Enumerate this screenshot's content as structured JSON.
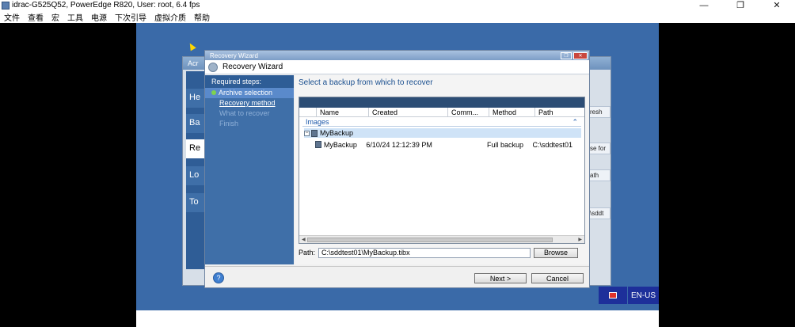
{
  "window": {
    "title": "idrac-G525Q52, PowerEdge R820, User: root, 6.4 fps",
    "minimize": "—",
    "restore": "❐",
    "close": "✕"
  },
  "menubar": {
    "items": [
      "文件",
      "查看",
      "宏",
      "工具",
      "电源",
      "下次引导",
      "虚拟介质",
      "帮助"
    ]
  },
  "background_app": {
    "title": "Acr",
    "nav": [
      "He",
      "Ba",
      "Re",
      "Lo",
      "To"
    ],
    "right_snippets": [
      "resh",
      "se for",
      "ath",
      "\\sddt"
    ]
  },
  "wizard": {
    "window_title": "Recovery Wizard",
    "header_title": "Recovery Wizard",
    "steps_heading": "Required steps:",
    "steps": [
      {
        "label": "Archive selection",
        "state": "current"
      },
      {
        "label": "Recovery method",
        "state": "active"
      },
      {
        "label": "What to recover",
        "state": "disabled"
      },
      {
        "label": "Finish",
        "state": "disabled"
      }
    ],
    "main_title": "Select a backup from which to recover",
    "columns": [
      "Name",
      "Created",
      "Comm...",
      "Method",
      "Path"
    ],
    "group_label": "Images",
    "tree_root": "MyBackup",
    "rows": [
      {
        "name": "MyBackup",
        "created": "6/10/24 12:12:39 PM",
        "comment": "",
        "method": "Full backup",
        "path": "C:\\sddtest01"
      }
    ],
    "path_label": "Path:",
    "path_value": "C:\\sddtest01\\MyBackup.tibx",
    "browse_label": "Browse",
    "next_label": "Next >",
    "cancel_label": "Cancel",
    "help_glyph": "?"
  },
  "tray": {
    "language": "EN-US"
  }
}
